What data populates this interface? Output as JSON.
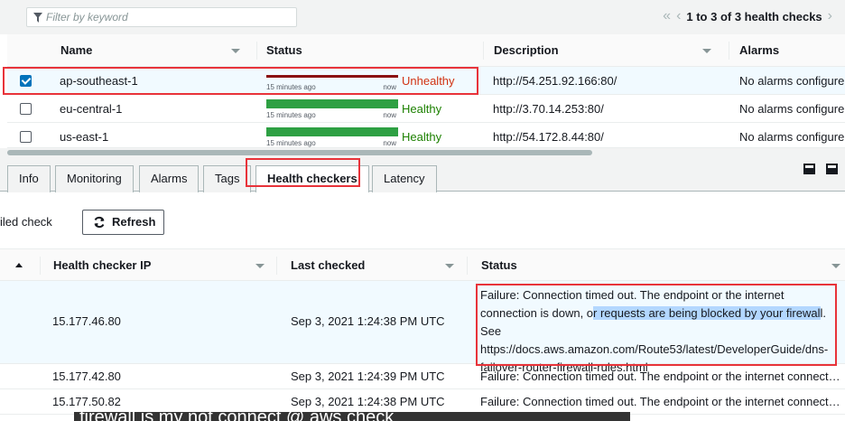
{
  "filter": {
    "placeholder": "Filter by keyword"
  },
  "pager": {
    "prev_first": "«",
    "prev": "‹",
    "count_label": "1 to 3 of 3 health checks",
    "next": "›"
  },
  "top_table": {
    "headers": {
      "name": "Name",
      "status": "Status",
      "description": "Description",
      "alarms": "Alarms"
    },
    "rows": [
      {
        "name": "ap-southeast-1",
        "spark_left": "15 minutes ago",
        "spark_right": "now",
        "state": "Unhealthy",
        "description": "http://54.251.92.166:80/",
        "alarms": "No alarms configure",
        "selected": true
      },
      {
        "name": "eu-central-1",
        "spark_left": "15 minutes ago",
        "spark_right": "now",
        "state": "Healthy",
        "description": "http://3.70.14.253:80/",
        "alarms": "No alarms configure",
        "selected": false
      },
      {
        "name": "us-east-1",
        "spark_left": "15 minutes ago",
        "spark_right": "now",
        "state": "Healthy",
        "description": "http://54.172.8.44:80/",
        "alarms": "No alarms configure",
        "selected": false
      }
    ]
  },
  "tabs": [
    "Info",
    "Monitoring",
    "Alarms",
    "Tags",
    "Health checkers",
    "Latency"
  ],
  "active_tab": "Health checkers",
  "details": {
    "failed_label": "iled check",
    "refresh_label": "Refresh",
    "headers": {
      "ip": "Health checker IP",
      "last_checked": "Last checked",
      "status": "Status"
    },
    "rows": [
      {
        "ip": "15.177.46.80",
        "last_checked": "Sep 3, 2021 1:24:38 PM UTC",
        "status_part1": "Failure: Connection timed out. The endpoint or the internet connection is down, o",
        "status_highlight": "r requests are being blocked by your firewal",
        "status_part2": "l. See https://docs.aws.amazon.com/Route53/latest/DeveloperGuide/dns-failover-router-firewall-rules.html"
      },
      {
        "ip": "15.177.42.80",
        "last_checked": "Sep 3, 2021 1:24:39 PM UTC",
        "status": "Failure: Connection timed out. The endpoint or the internet connecti…"
      },
      {
        "ip": "15.177.50.82",
        "last_checked": "Sep 3, 2021 1:24:38 PM UTC",
        "status": "Failure: Connection timed out. The endpoint or the internet connecti…"
      }
    ]
  },
  "caption": "firewall is my not connect @ aws check",
  "colors": {
    "selected_row": "#f1faff",
    "unhealthy": "#d13212",
    "healthy": "#1d8102",
    "annotation": "#e8333a"
  }
}
